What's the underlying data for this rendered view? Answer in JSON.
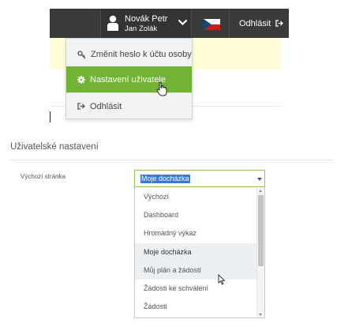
{
  "header": {
    "user_name": "Novák Petr",
    "user_sub": "Jan Zolák",
    "logout_label": "Odhlásit",
    "language_flag": "czech-flag"
  },
  "user_menu": {
    "items": [
      {
        "label": "Změnit heslo k účtu osoby",
        "icon": "key-icon"
      },
      {
        "label": "Nastavení uživatele",
        "icon": "gear-icon",
        "active": true
      },
      {
        "label": "Odhlásit",
        "icon": "sign-out-icon"
      }
    ]
  },
  "settings": {
    "title": "Uživatelské nastavení",
    "start_page_label": "Výchozí stránka",
    "start_page_value": "Moje docházka",
    "options": [
      "Výchozí",
      "Dashboard",
      "Hromadný výkaz",
      "Moje docházka",
      "Můj plán a žádosti",
      "Žádosti ke schválení",
      "Žádosti"
    ]
  },
  "colors": {
    "topbar": "#3a3a3a",
    "accent_green": "#72b335",
    "notice_yellow": "#fffdd8",
    "selection_blue": "#3b78d8"
  }
}
